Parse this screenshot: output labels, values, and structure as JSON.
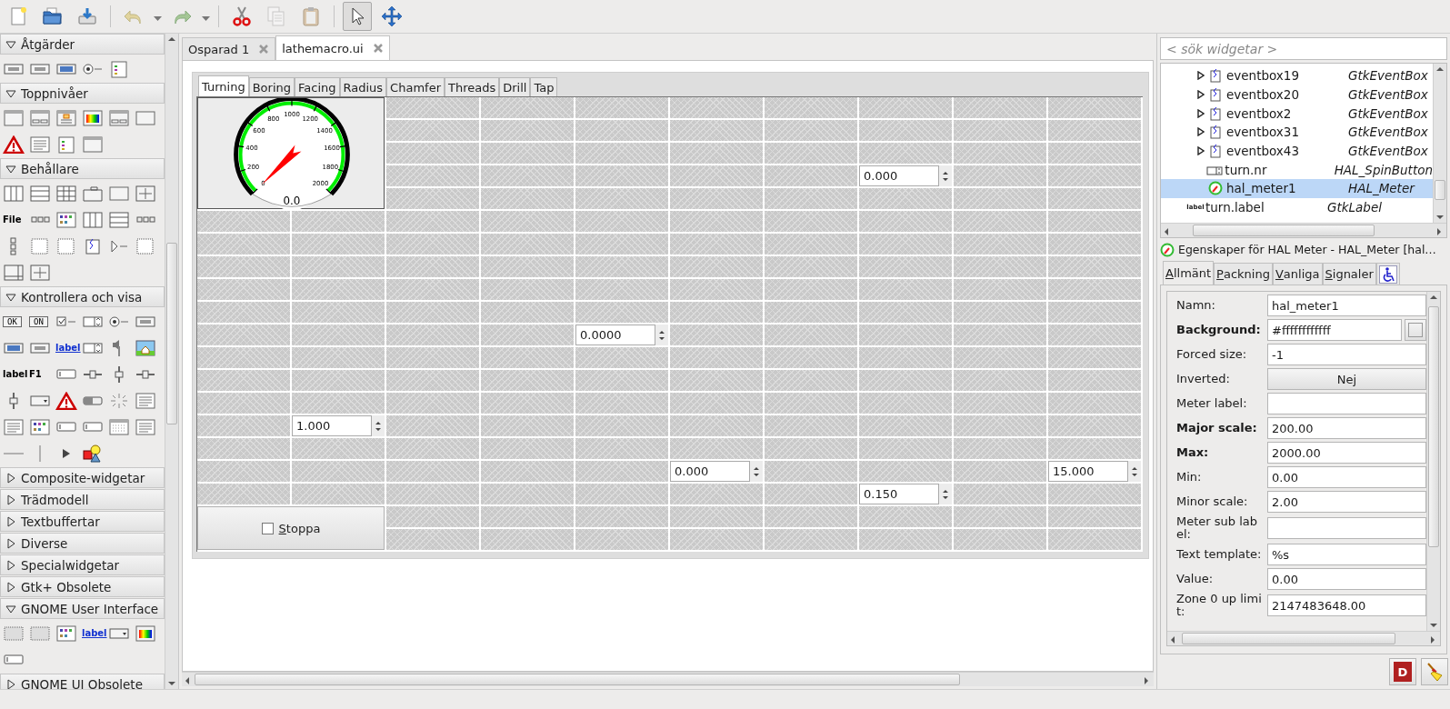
{
  "toolbar": {
    "items": [
      {
        "kind": "button",
        "disabled": false
      },
      {
        "kind": "button",
        "disabled": false
      },
      {
        "kind": "button",
        "disabled": false
      },
      {
        "kind": "separator"
      },
      {
        "kind": "button",
        "disabled": true
      },
      {
        "kind": "dropdown"
      },
      {
        "kind": "button",
        "disabled": true
      },
      {
        "kind": "dropdown"
      },
      {
        "kind": "separator"
      },
      {
        "kind": "button",
        "disabled": false
      },
      {
        "kind": "button",
        "disabled": true
      },
      {
        "kind": "button",
        "disabled": true
      },
      {
        "kind": "separator"
      },
      {
        "kind": "mode",
        "selected": true
      },
      {
        "kind": "mode",
        "selected": false
      }
    ]
  },
  "palette": {
    "groups": [
      {
        "title": "Åtgärder",
        "expanded": true,
        "items": [
          {
            "kind": "icon"
          },
          {
            "kind": "icon"
          },
          {
            "kind": "icon"
          },
          {
            "kind": "icon"
          },
          {
            "kind": "icon"
          }
        ]
      },
      {
        "title": "Toppnivåer",
        "expanded": true,
        "items": [
          {
            "kind": "icon"
          },
          {
            "kind": "icon"
          },
          {
            "kind": "icon"
          },
          {
            "kind": "icon"
          },
          {
            "kind": "icon"
          },
          {
            "kind": "icon"
          },
          {
            "kind": "icon"
          },
          {
            "kind": "icon"
          },
          {
            "kind": "icon"
          },
          {
            "kind": "icon"
          }
        ]
      },
      {
        "title": "Behållare",
        "expanded": true,
        "items": [
          {
            "kind": "icon"
          },
          {
            "kind": "icon"
          },
          {
            "kind": "icon"
          },
          {
            "kind": "icon"
          },
          {
            "kind": "icon"
          },
          {
            "kind": "icon"
          },
          {
            "kind": "bold",
            "text": "File"
          },
          {
            "kind": "icon"
          },
          {
            "kind": "icon"
          },
          {
            "kind": "icon"
          },
          {
            "kind": "icon"
          },
          {
            "kind": "icon"
          },
          {
            "kind": "icon"
          },
          {
            "kind": "icon"
          },
          {
            "kind": "icon"
          },
          {
            "kind": "icon"
          },
          {
            "kind": "icon"
          },
          {
            "kind": "icon"
          },
          {
            "kind": "icon"
          },
          {
            "kind": "icon"
          }
        ]
      },
      {
        "title": "Kontrollera och visa",
        "expanded": true,
        "items": [
          {
            "kind": "boxed",
            "text": "OK"
          },
          {
            "kind": "boxed",
            "text": "ON"
          },
          {
            "kind": "icon"
          },
          {
            "kind": "icon"
          },
          {
            "kind": "icon"
          },
          {
            "kind": "icon"
          },
          {
            "kind": "icon"
          },
          {
            "kind": "icon"
          },
          {
            "kind": "link",
            "text": "label"
          },
          {
            "kind": "icon"
          },
          {
            "kind": "icon"
          },
          {
            "kind": "icon"
          },
          {
            "kind": "bold",
            "text": "label"
          },
          {
            "kind": "bold",
            "text": "F1"
          },
          {
            "kind": "icon"
          },
          {
            "kind": "icon"
          },
          {
            "kind": "icon"
          },
          {
            "kind": "icon"
          },
          {
            "kind": "icon"
          },
          {
            "kind": "icon"
          },
          {
            "kind": "icon"
          },
          {
            "kind": "icon"
          },
          {
            "kind": "icon"
          },
          {
            "kind": "icon"
          },
          {
            "kind": "icon"
          },
          {
            "kind": "icon"
          },
          {
            "kind": "icon"
          },
          {
            "kind": "icon"
          },
          {
            "kind": "icon"
          },
          {
            "kind": "icon"
          },
          {
            "kind": "icon"
          },
          {
            "kind": "icon"
          },
          {
            "kind": "icon"
          },
          {
            "kind": "icon"
          }
        ]
      },
      {
        "title": "Composite-widgetar",
        "expanded": false
      },
      {
        "title": "Trädmodell",
        "expanded": false
      },
      {
        "title": "Textbuffertar",
        "expanded": false
      },
      {
        "title": "Diverse",
        "expanded": false
      },
      {
        "title": "Specialwidgetar",
        "expanded": false
      },
      {
        "title": "Gtk+ Obsolete",
        "expanded": false
      },
      {
        "title": "GNOME User Interface",
        "expanded": true,
        "items": [
          {
            "kind": "icon"
          },
          {
            "kind": "icon"
          },
          {
            "kind": "icon"
          },
          {
            "kind": "link",
            "text": "label"
          },
          {
            "kind": "icon"
          },
          {
            "kind": "icon"
          },
          {
            "kind": "icon"
          }
        ]
      },
      {
        "title": "GNOME UI Obsolete",
        "expanded": false
      }
    ]
  },
  "documents": [
    {
      "title": "Osparad 1",
      "selected": false
    },
    {
      "title": "lathemacro.ui",
      "selected": true
    }
  ],
  "design": {
    "tabs": [
      {
        "label": "Turning",
        "selected": true
      },
      {
        "label": "Boring",
        "selected": false
      },
      {
        "label": "Facing",
        "selected": false
      },
      {
        "label": "Radius",
        "selected": false
      },
      {
        "label": "Chamfer",
        "selected": false
      },
      {
        "label": "Threads",
        "selected": false
      },
      {
        "label": "Drill",
        "selected": false
      },
      {
        "label": "Tap",
        "selected": false
      }
    ],
    "grid": {
      "rows": [
        [
          {
            "kind": "meter",
            "ticks": [
              "0",
              "200",
              "400",
              "600",
              "800",
              "1000",
              "1200",
              "1400",
              "1600",
              "1800",
              "2000"
            ],
            "reading": "0.0"
          },
          {
            "kind": "covered"
          },
          {
            "kind": "empty"
          },
          {
            "kind": "empty"
          },
          {
            "kind": "empty"
          },
          {
            "kind": "empty"
          },
          {
            "kind": "empty"
          },
          {
            "kind": "empty"
          },
          {
            "kind": "empty"
          },
          {
            "kind": "empty"
          }
        ],
        [
          {
            "kind": "covered"
          },
          {
            "kind": "covered"
          },
          {
            "kind": "empty"
          },
          {
            "kind": "empty"
          },
          {
            "kind": "empty"
          },
          {
            "kind": "empty"
          },
          {
            "kind": "empty"
          },
          {
            "kind": "empty"
          },
          {
            "kind": "empty"
          },
          {
            "kind": "empty"
          }
        ],
        [
          {
            "kind": "covered"
          },
          {
            "kind": "covered"
          },
          {
            "kind": "empty"
          },
          {
            "kind": "empty"
          },
          {
            "kind": "empty"
          },
          {
            "kind": "empty"
          },
          {
            "kind": "empty"
          },
          {
            "kind": "empty"
          },
          {
            "kind": "empty"
          },
          {
            "kind": "empty"
          }
        ],
        [
          {
            "kind": "covered"
          },
          {
            "kind": "covered"
          },
          {
            "kind": "empty"
          },
          {
            "kind": "empty"
          },
          {
            "kind": "empty"
          },
          {
            "kind": "empty"
          },
          {
            "kind": "empty"
          },
          {
            "kind": "spin",
            "value": "0.000"
          },
          {
            "kind": "empty"
          },
          {
            "kind": "empty"
          }
        ],
        [
          {
            "kind": "covered"
          },
          {
            "kind": "covered"
          },
          {
            "kind": "empty"
          },
          {
            "kind": "empty"
          },
          {
            "kind": "empty"
          },
          {
            "kind": "empty"
          },
          {
            "kind": "empty"
          },
          {
            "kind": "empty"
          },
          {
            "kind": "empty"
          },
          {
            "kind": "empty"
          }
        ],
        [
          {
            "kind": "empty"
          },
          {
            "kind": "empty"
          },
          {
            "kind": "empty"
          },
          {
            "kind": "empty"
          },
          {
            "kind": "empty"
          },
          {
            "kind": "empty"
          },
          {
            "kind": "empty"
          },
          {
            "kind": "empty"
          },
          {
            "kind": "empty"
          },
          {
            "kind": "empty"
          }
        ],
        [
          {
            "kind": "empty"
          },
          {
            "kind": "empty"
          },
          {
            "kind": "empty"
          },
          {
            "kind": "empty"
          },
          {
            "kind": "empty"
          },
          {
            "kind": "empty"
          },
          {
            "kind": "empty"
          },
          {
            "kind": "empty"
          },
          {
            "kind": "empty"
          },
          {
            "kind": "empty"
          }
        ],
        [
          {
            "kind": "empty"
          },
          {
            "kind": "empty"
          },
          {
            "kind": "empty"
          },
          {
            "kind": "empty"
          },
          {
            "kind": "empty"
          },
          {
            "kind": "empty"
          },
          {
            "kind": "empty"
          },
          {
            "kind": "empty"
          },
          {
            "kind": "empty"
          },
          {
            "kind": "empty"
          }
        ],
        [
          {
            "kind": "empty"
          },
          {
            "kind": "empty"
          },
          {
            "kind": "empty"
          },
          {
            "kind": "empty"
          },
          {
            "kind": "empty"
          },
          {
            "kind": "empty"
          },
          {
            "kind": "empty"
          },
          {
            "kind": "empty"
          },
          {
            "kind": "empty"
          },
          {
            "kind": "empty"
          }
        ],
        [
          {
            "kind": "empty"
          },
          {
            "kind": "empty"
          },
          {
            "kind": "empty"
          },
          {
            "kind": "empty"
          },
          {
            "kind": "empty"
          },
          {
            "kind": "empty"
          },
          {
            "kind": "empty"
          },
          {
            "kind": "empty"
          },
          {
            "kind": "empty"
          },
          {
            "kind": "empty"
          }
        ],
        [
          {
            "kind": "empty"
          },
          {
            "kind": "empty"
          },
          {
            "kind": "empty"
          },
          {
            "kind": "empty"
          },
          {
            "kind": "spin",
            "value": "0.0000"
          },
          {
            "kind": "empty"
          },
          {
            "kind": "empty"
          },
          {
            "kind": "empty"
          },
          {
            "kind": "empty"
          },
          {
            "kind": "empty"
          }
        ],
        [
          {
            "kind": "empty"
          },
          {
            "kind": "empty"
          },
          {
            "kind": "empty"
          },
          {
            "kind": "empty"
          },
          {
            "kind": "empty"
          },
          {
            "kind": "empty"
          },
          {
            "kind": "empty"
          },
          {
            "kind": "empty"
          },
          {
            "kind": "empty"
          },
          {
            "kind": "empty"
          }
        ],
        [
          {
            "kind": "empty"
          },
          {
            "kind": "empty"
          },
          {
            "kind": "empty"
          },
          {
            "kind": "empty"
          },
          {
            "kind": "empty"
          },
          {
            "kind": "empty"
          },
          {
            "kind": "empty"
          },
          {
            "kind": "empty"
          },
          {
            "kind": "empty"
          },
          {
            "kind": "empty"
          }
        ],
        [
          {
            "kind": "empty"
          },
          {
            "kind": "empty"
          },
          {
            "kind": "empty"
          },
          {
            "kind": "empty"
          },
          {
            "kind": "empty"
          },
          {
            "kind": "empty"
          },
          {
            "kind": "empty"
          },
          {
            "kind": "empty"
          },
          {
            "kind": "empty"
          },
          {
            "kind": "empty"
          }
        ],
        [
          {
            "kind": "empty"
          },
          {
            "kind": "spin",
            "value": "1.000"
          },
          {
            "kind": "empty"
          },
          {
            "kind": "empty"
          },
          {
            "kind": "empty"
          },
          {
            "kind": "empty"
          },
          {
            "kind": "empty"
          },
          {
            "kind": "empty"
          },
          {
            "kind": "empty"
          },
          {
            "kind": "empty"
          }
        ],
        [
          {
            "kind": "empty"
          },
          {
            "kind": "empty"
          },
          {
            "kind": "empty"
          },
          {
            "kind": "empty"
          },
          {
            "kind": "empty"
          },
          {
            "kind": "empty"
          },
          {
            "kind": "empty"
          },
          {
            "kind": "empty"
          },
          {
            "kind": "empty"
          },
          {
            "kind": "empty"
          }
        ],
        [
          {
            "kind": "empty"
          },
          {
            "kind": "empty"
          },
          {
            "kind": "empty"
          },
          {
            "kind": "empty"
          },
          {
            "kind": "empty"
          },
          {
            "kind": "spin",
            "value": "0.000"
          },
          {
            "kind": "empty"
          },
          {
            "kind": "empty"
          },
          {
            "kind": "empty"
          },
          {
            "kind": "spin",
            "value": "15.000"
          }
        ],
        [
          {
            "kind": "empty"
          },
          {
            "kind": "empty"
          },
          {
            "kind": "empty"
          },
          {
            "kind": "empty"
          },
          {
            "kind": "empty"
          },
          {
            "kind": "empty"
          },
          {
            "kind": "empty"
          },
          {
            "kind": "spin",
            "value": "0.150"
          },
          {
            "kind": "empty"
          },
          {
            "kind": "empty"
          }
        ],
        [
          {
            "kind": "check_button",
            "label": "Stoppa",
            "checked": false
          },
          {
            "kind": "covered"
          },
          {
            "kind": "empty"
          },
          {
            "kind": "empty"
          },
          {
            "kind": "empty"
          },
          {
            "kind": "empty"
          },
          {
            "kind": "empty"
          },
          {
            "kind": "empty"
          },
          {
            "kind": "empty"
          },
          {
            "kind": "empty"
          }
        ],
        [
          {
            "kind": "covered"
          },
          {
            "kind": "covered"
          },
          {
            "kind": "empty"
          },
          {
            "kind": "empty"
          },
          {
            "kind": "empty"
          },
          {
            "kind": "empty"
          },
          {
            "kind": "empty"
          },
          {
            "kind": "empty"
          },
          {
            "kind": "empty"
          },
          {
            "kind": "empty"
          }
        ]
      ]
    }
  },
  "inspector": {
    "search": {
      "placeholder": "< sök widgetar >"
    },
    "tree": [
      {
        "children": [
          {
            "name": "eventbox19",
            "type": "GtkEventBox",
            "kind": "eventbox",
            "expanded": false,
            "selected": false
          },
          {
            "name": "eventbox20",
            "type": "GtkEventBox",
            "kind": "eventbox",
            "expanded": false,
            "selected": false
          },
          {
            "name": "eventbox2",
            "type": "GtkEventBox",
            "kind": "eventbox",
            "expanded": false,
            "selected": false
          },
          {
            "name": "eventbox31",
            "type": "GtkEventBox",
            "kind": "eventbox",
            "expanded": false,
            "selected": false
          },
          {
            "name": "eventbox43",
            "type": "GtkEventBox",
            "kind": "eventbox",
            "expanded": false,
            "selected": false
          },
          {
            "name": "turn.nr",
            "type": "HAL_SpinButton",
            "kind": "spin",
            "selected": false
          },
          {
            "name": "hal_meter1",
            "type": "HAL_Meter",
            "kind": "meter",
            "selected": true
          }
        ]
      },
      {
        "name": "turn.label",
        "type": "GtkLabel",
        "kind": "label",
        "icon_text": "label",
        "selected": false
      }
    ]
  },
  "properties": {
    "title": "Egenskaper för HAL Meter - HAL_Meter [hal…",
    "tabs": [
      {
        "kind": "text",
        "label": "Allmänt",
        "selected": true
      },
      {
        "kind": "text",
        "label": "Packning",
        "selected": false
      },
      {
        "kind": "text",
        "label": "Vanliga",
        "selected": false
      },
      {
        "kind": "text",
        "label": "Signaler",
        "selected": false
      },
      {
        "kind": "icon",
        "selected": false
      }
    ],
    "rows": [
      {
        "label": "Namn:",
        "bold": false,
        "kind": "entry",
        "value": "hal_meter1"
      },
      {
        "label": "Background:",
        "bold": true,
        "kind": "color",
        "value": "#ffffffffffff"
      },
      {
        "label": "Forced size:",
        "bold": false,
        "kind": "entry",
        "value": "-1"
      },
      {
        "label": "Inverted:",
        "bold": false,
        "kind": "toggle",
        "value": "Nej"
      },
      {
        "label": "Meter label:",
        "bold": false,
        "kind": "entry"
      },
      {
        "label": "Major scale:",
        "bold": true,
        "kind": "entry",
        "value": "200.00"
      },
      {
        "label": "Max:",
        "bold": true,
        "kind": "entry",
        "value": "2000.00"
      },
      {
        "label": "Min:",
        "bold": false,
        "kind": "entry",
        "value": "0.00"
      },
      {
        "label": "Minor scale:",
        "bold": false,
        "kind": "entry",
        "value": "2.00"
      },
      {
        "label": "Meter sub label:",
        "bold": false,
        "kind": "entry"
      },
      {
        "label": "Text template:",
        "bold": false,
        "kind": "entry",
        "value": "%s"
      },
      {
        "label": "Value:",
        "bold": false,
        "kind": "entry",
        "value": "0.00"
      },
      {
        "label": "Zone 0 up limit:",
        "bold": false,
        "kind": "entry",
        "value": "2147483648.00"
      }
    ],
    "defaults_button": {
      "text": "D"
    }
  }
}
